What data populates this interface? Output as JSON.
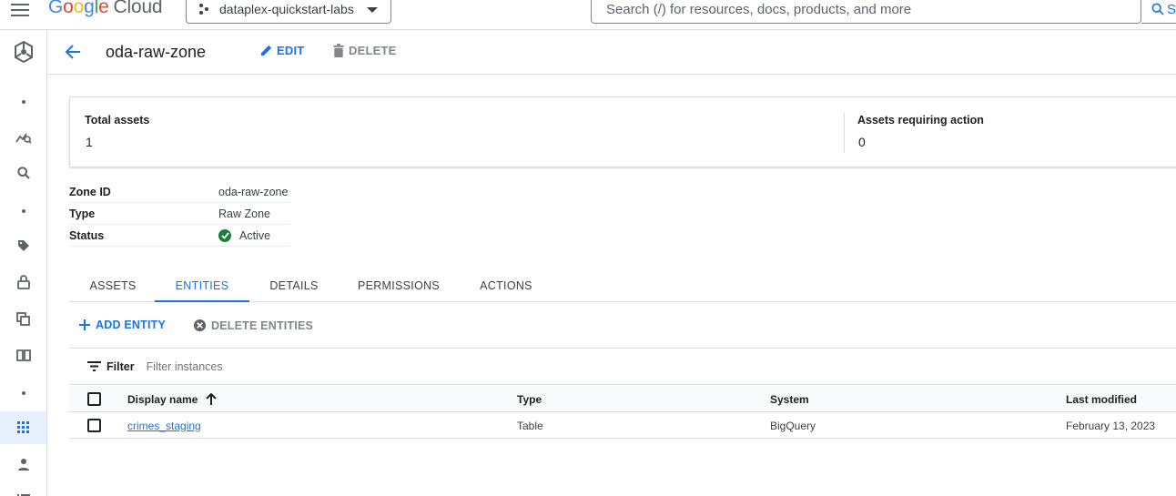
{
  "topbar": {
    "logo_google": [
      "G",
      "o",
      "o",
      "g",
      "l",
      "e"
    ],
    "logo_cloud": "Cloud",
    "project": "dataplex-quickstart-labs",
    "search_placeholder": "Search (/) for resources, docs, products, and more",
    "search_button": "S"
  },
  "rail": {
    "items": [
      "dataplex-icon",
      "more-icon",
      "analytics-icon",
      "search-icon",
      "more-icon",
      "tag-icon",
      "lock-icon",
      "copy-icon",
      "book-icon",
      "more-icon",
      "grid-icon",
      "person-icon",
      "list-icon"
    ],
    "active": "grid-icon"
  },
  "header": {
    "title": "oda-raw-zone",
    "edit_label": "EDIT",
    "delete_label": "DELETE"
  },
  "summary": {
    "total_assets_label": "Total assets",
    "total_assets_value": "1",
    "action_label": "Assets requiring action",
    "action_value": "0"
  },
  "properties": [
    {
      "key": "Zone ID",
      "value": "oda-raw-zone"
    },
    {
      "key": "Type",
      "value": "Raw Zone"
    },
    {
      "key": "Status",
      "value": "Active"
    }
  ],
  "tabs": [
    "ASSETS",
    "ENTITIES",
    "DETAILS",
    "PERMISSIONS",
    "ACTIONS"
  ],
  "active_tab": "ENTITIES",
  "actions": {
    "add_label": "ADD ENTITY",
    "delete_label": "DELETE ENTITIES"
  },
  "filter": {
    "label": "Filter",
    "placeholder": "Filter instances"
  },
  "table": {
    "columns": [
      "Display name",
      "Type",
      "System",
      "Last modified"
    ],
    "sort_column": "Display name",
    "sort_direction": "ascending",
    "rows": [
      {
        "name": "crimes_staging",
        "type": "Table",
        "system": "BigQuery",
        "modified": "February 13, 2023"
      }
    ]
  },
  "colors": {
    "accent": "#1a73e8",
    "status_ok": "#188038",
    "rail_active": "#e8f0fe"
  }
}
